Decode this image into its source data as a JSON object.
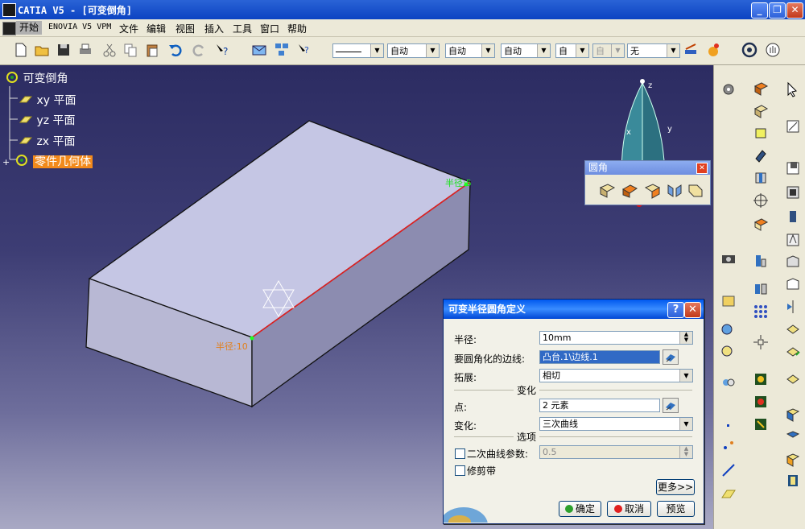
{
  "window": {
    "title": "CATIA V5 - [可变倒角]"
  },
  "menu": [
    "开始",
    "ENOVIA V5 VPM",
    "文件",
    "编辑",
    "视图",
    "插入",
    "工具",
    "窗口",
    "帮助"
  ],
  "toolbar": {
    "combos": [
      "",
      "自动",
      "自动",
      "自动",
      "自",
      "自",
      "无"
    ]
  },
  "tree": {
    "root": "可变倒角",
    "items": [
      {
        "label": "xy 平面"
      },
      {
        "label": "yz 平面"
      },
      {
        "label": "zx 平面"
      }
    ],
    "body": "零件几何体"
  },
  "model": {
    "radius_label_1": "半径:5",
    "radius_label_2": "半径:10"
  },
  "compass": {
    "x": "x",
    "y": "y",
    "z": "z"
  },
  "fillet_toolbar": {
    "title": "圆角"
  },
  "dialog": {
    "title": "可变半径圆角定义",
    "radius_label": "半径:",
    "radius_value": "10mm",
    "edges_label": "要圆角化的边线:",
    "edges_value": "凸台.1\\边线.1",
    "propagation_label": "拓展:",
    "propagation_value": "相切",
    "variation_section": "变化",
    "points_label": "点:",
    "points_value": "2 元素",
    "variation_label": "变化:",
    "variation_value": "三次曲线",
    "options_section": "选项",
    "conic_label": "二次曲线参数:",
    "conic_value": "0.5",
    "trim_label": "修剪带",
    "more_button": "更多>>",
    "ok_button": "确定",
    "cancel_button": "取消",
    "preview_button": "预览"
  },
  "colors": {
    "background_top": "#2c2c62",
    "tree_selected": "#f28a1c",
    "edge_highlight": "#e02020",
    "dialog_title": "#0058ee"
  }
}
